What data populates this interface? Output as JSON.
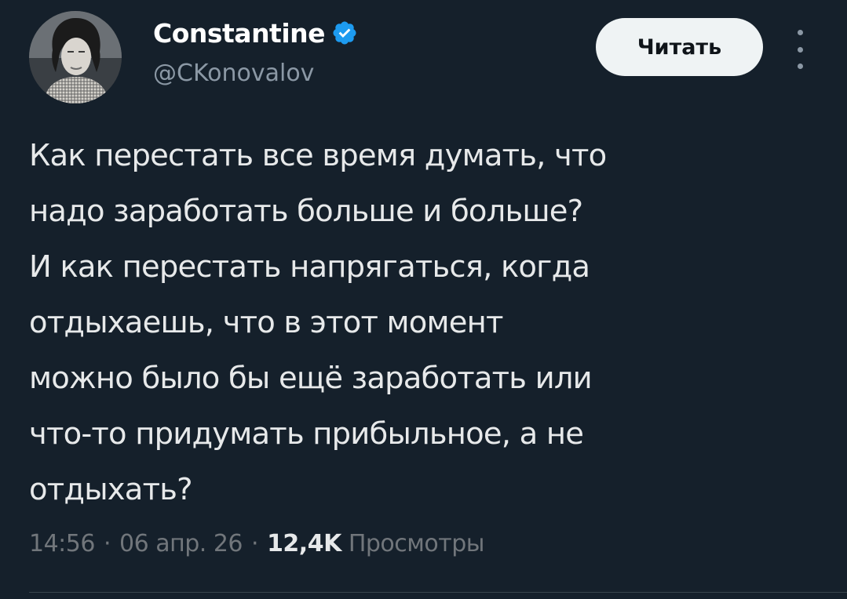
{
  "author": {
    "display_name": "Constantine",
    "handle": "@CKonovalov",
    "verified": true
  },
  "actions": {
    "follow_label": "Читать"
  },
  "tweet": {
    "lines": [
      "Как перестать все время думать, что",
      "надо заработать больше и больше?",
      "И как перестать напрягаться, когда",
      "отдыхаешь, что в этот момент",
      "можно было бы ещё заработать или",
      "что-то придумать прибыльное, а не",
      "отдыхать?"
    ]
  },
  "meta": {
    "time": "14:56",
    "separator": "·",
    "date": "06 апр. 26",
    "views_count": "12,4K",
    "views_label": "Просмотры"
  },
  "icons": {
    "verified": "verified-badge-icon",
    "more": "vertical-ellipsis-icon"
  },
  "colors": {
    "background": "#15202b",
    "text_primary": "#e7e9ea",
    "text_secondary": "#71767b",
    "verified_blue": "#1d9bf0",
    "follow_button_bg": "#eff3f4"
  }
}
